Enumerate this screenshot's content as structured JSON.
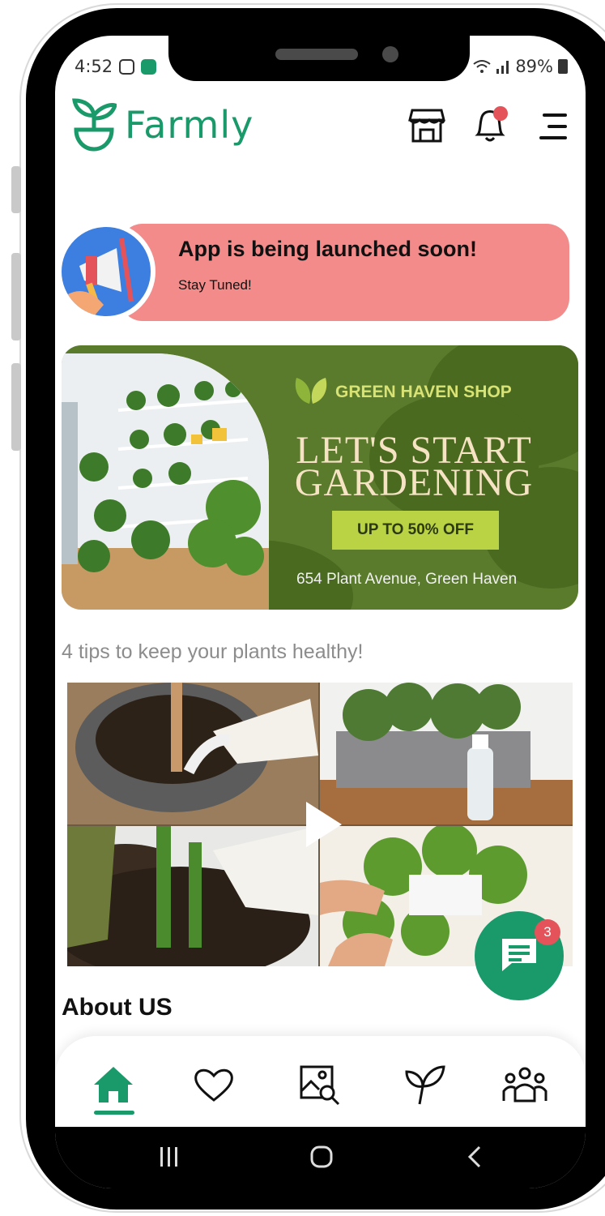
{
  "status_bar": {
    "time": "4:52",
    "battery": "89%"
  },
  "header": {
    "app_name": "Farmly"
  },
  "announcement": {
    "title": "App is being launched soon!",
    "subtitle": "Stay Tuned!"
  },
  "promo": {
    "shop_name": "GREEN HAVEN SHOP",
    "headline_line1": "LET'S START",
    "headline_line2": "GARDENING",
    "cta": "UP TO 50% OFF",
    "address": "654 Plant Avenue, Green Haven"
  },
  "tips": {
    "title": "4 tips to keep your plants healthy!"
  },
  "chat": {
    "badge_count": "3"
  },
  "about": {
    "title": "About US"
  },
  "bottom_nav": {
    "items": [
      {
        "icon": "home-icon",
        "active": true
      },
      {
        "icon": "heart-icon",
        "active": false
      },
      {
        "icon": "image-search-icon",
        "active": false
      },
      {
        "icon": "plant-icon",
        "active": false
      },
      {
        "icon": "community-icon",
        "active": false
      }
    ]
  },
  "colors": {
    "brand": "#1a9a6b",
    "banner": "#f48b8b",
    "promo_bg": "#5a7a2c",
    "promo_cta": "#b9d344",
    "badge": "#e4535a"
  }
}
